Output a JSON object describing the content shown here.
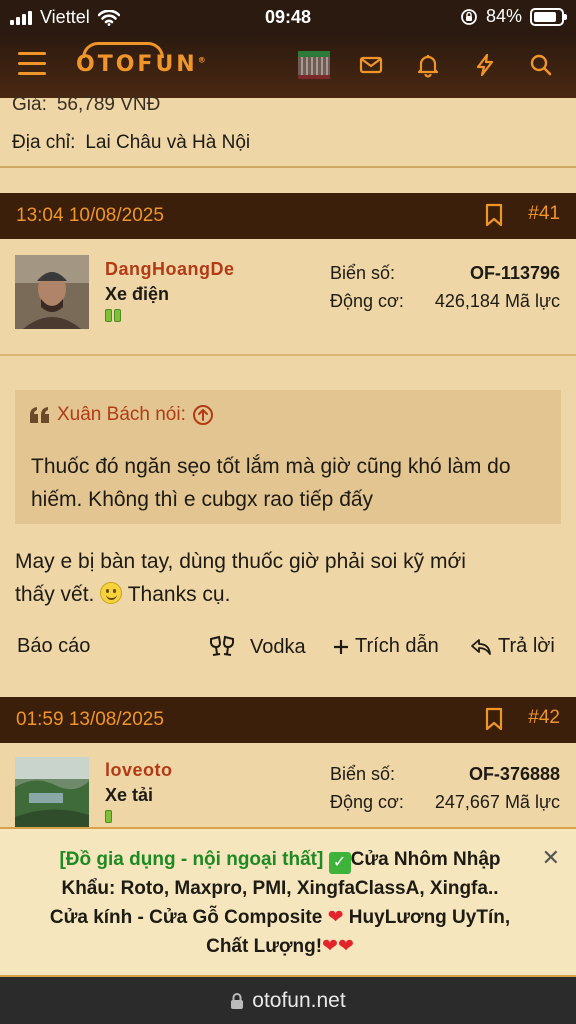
{
  "status_bar": {
    "carrier": "Viettel",
    "time": "09:48",
    "battery": "84%",
    "battery_level": 0.84
  },
  "app_bar": {
    "logo": "OTOFUN",
    "colors": {
      "accent": "#f0952a",
      "header_bg": "#3c1f0a"
    }
  },
  "prev_post": {
    "price_label": "Giá:",
    "price_value": "56,789 VNĐ",
    "address_label": "Địa chỉ:",
    "address_value": "Lai Châu và Hà Nội"
  },
  "posts": [
    {
      "date": "13:04 10/08/2025",
      "number": "#41",
      "username": "DangHoangDe",
      "user_title": "Xe điện",
      "plate_label": "Biển số:",
      "plate_value": "OF-113796",
      "engine_label": "Động cơ:",
      "engine_value": "426,184 Mã lực",
      "quote_author": "Xuân Bách nói:",
      "quote_text": "Thuốc đó ngăn sẹo tốt lắm mà giờ cũng khó làm do hiếm. Không thì e cubgx rao tiếp đấy",
      "body_line1": "May e bị bàn tay, dùng thuốc giờ phải soi kỹ mới",
      "body_line2_before": "thấy vết.",
      "body_line2_after": "Thanks cụ.",
      "report": "Báo cáo",
      "vodka": "Vodka",
      "quote_action": "Trích dẫn",
      "reply": "Trả lời"
    },
    {
      "date": "01:59 13/08/2025",
      "number": "#42",
      "username": "loveoto",
      "user_title": "Xe tải",
      "plate_label": "Biển số:",
      "plate_value": "OF-376888",
      "engine_label": "Động cơ:",
      "engine_value": "247,667 Mã lực"
    }
  ],
  "ad": {
    "tag": "[Đồ gia dụng - nội ngoại thất]",
    "line1": "Cửa Nhôm Nhập",
    "line2": "Khẩu: Roto, Maxpro, PMI, XingfaClassA, Xingfa..",
    "line3_before": "Cửa kính - Cửa Gỗ Composite",
    "line3_after": "HuyLương UyTín,",
    "line4": "Chất Lượng!",
    "close": "✕"
  },
  "url_bar": {
    "url": "otofun.net"
  }
}
